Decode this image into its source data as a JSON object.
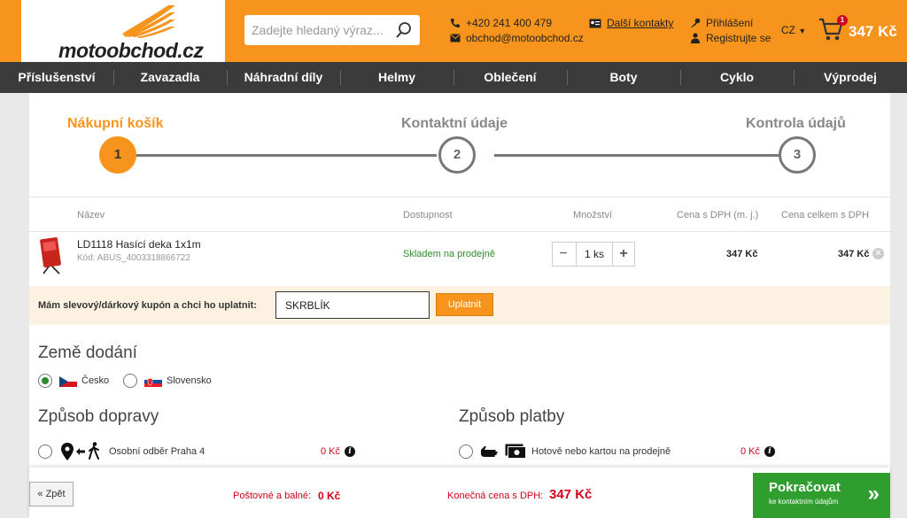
{
  "header": {
    "logo_text": "motoobchod.cz",
    "search_placeholder": "Zadejte hledaný výraz...",
    "phone": "+420 241 400 479",
    "email": "obchod@motoobchod.cz",
    "more_contacts": "Další kontakty",
    "login": "Přihlášení",
    "register": "Registrujte se",
    "language": "CZ",
    "cart_count": "1",
    "cart_total": "347 Kč",
    "colors": {
      "brand": "#f7941d",
      "nav": "#3b3b3b"
    }
  },
  "nav": {
    "items": [
      "Příslušenství",
      "Zavazadla",
      "Náhradní díly",
      "Helmy",
      "Oblečení",
      "Boty",
      "Cyklo",
      "Výprodej"
    ]
  },
  "steps": [
    {
      "label": "Nákupní košík",
      "number": "1"
    },
    {
      "label": "Kontaktní údaje",
      "number": "2"
    },
    {
      "label": "Kontrola údajů",
      "number": "3"
    }
  ],
  "table": {
    "headers": [
      "Název",
      "Dostupnost",
      "Množství",
      "Cena s DPH (m. j.)",
      "Cena celkem s DPH"
    ],
    "rows": [
      {
        "name": "LD1118 Hasící deka 1x1m",
        "code": "Kód: ABUS_4003318866722",
        "availability": "Skladem na prodejně",
        "quantity": "1 ks",
        "unit_price": "347 Kč",
        "total_price": "347 Kč"
      }
    ]
  },
  "coupon": {
    "label": "Mám slevový/dárkový kupón a chci ho uplatnit:",
    "value": "SKRBLÍK",
    "button": "Uplatnit"
  },
  "country": {
    "title": "Země dodání",
    "options": [
      {
        "label": "Česko",
        "checked": true
      },
      {
        "label": "Slovensko",
        "checked": false
      }
    ]
  },
  "shipping": {
    "title": "Způsob dopravy",
    "option_label": "Osobní odběr Praha 4",
    "option_price": "0 Kč"
  },
  "payment": {
    "title": "Způsob platby",
    "option_label": "Hotově nebo kartou na prodejně",
    "option_price": "0 Kč"
  },
  "footer": {
    "back": "Zpět",
    "postage_label": "Poštovné a balné:",
    "postage_value": "0 Kč",
    "total_label": "Konečná cena s DPH:",
    "total_value": "347 Kč",
    "continue_main": "Pokračovat",
    "continue_sub": "ke kontaktním údajům"
  }
}
